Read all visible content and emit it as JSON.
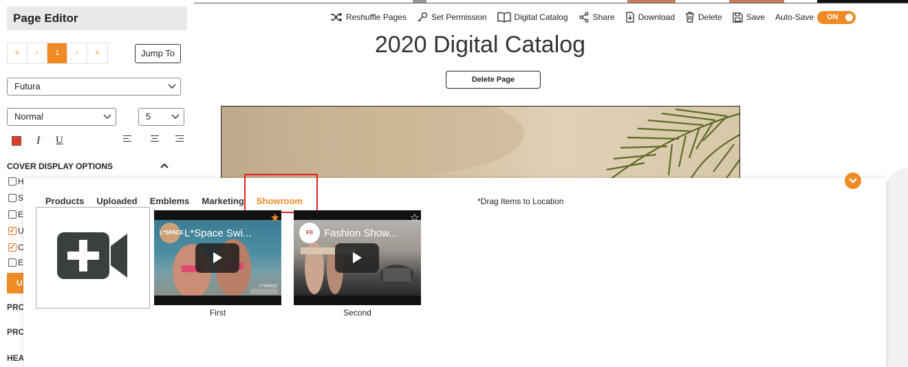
{
  "sidebar": {
    "title": "Page Editor",
    "pager": [
      "«",
      "‹",
      "1",
      "›",
      "»"
    ],
    "jump_label": "Jump To",
    "font_select": "Futura",
    "style_select": "Normal",
    "size_select": "5",
    "format": {
      "italic": "I",
      "underline": "U",
      "color": "#e03a2c"
    },
    "cover_options_title": "COVER DISPLAY OPTIONS",
    "checkbox_labels": [
      "H",
      "S",
      "E",
      "U",
      "C",
      "E"
    ],
    "checkbox_states": [
      false,
      false,
      false,
      true,
      true,
      false
    ],
    "orange_button_label": "U",
    "section_heads": [
      "PRC",
      "PRC",
      "HEA"
    ]
  },
  "toolbar": {
    "reshuffle": "Reshuffle Pages",
    "permission": "Set Permission",
    "catalog": "Digital Catalog",
    "share": "Share",
    "download": "Download",
    "delete": "Delete",
    "save": "Save",
    "autosave": "Auto-Save",
    "autosave_state": "ON"
  },
  "main": {
    "title": "2020 Digital Catalog",
    "delete_page": "Delete Page"
  },
  "panel": {
    "tabs": [
      "Products",
      "Uploaded",
      "Emblems",
      "Marketing",
      "Showroom"
    ],
    "active_tab": "Showroom",
    "drag_hint": "*Drag Items to Location",
    "videos": [
      {
        "title": "L*Space Swi...",
        "label": "First",
        "logo": "L*SPACE",
        "watermark": "L*SPACE",
        "starred": true
      },
      {
        "title": "Fashion Show...",
        "label": "Second",
        "logo": "FII",
        "starred": false
      }
    ]
  },
  "colors": {
    "accent": "#f08a24",
    "highlight": "#e41e1e"
  }
}
